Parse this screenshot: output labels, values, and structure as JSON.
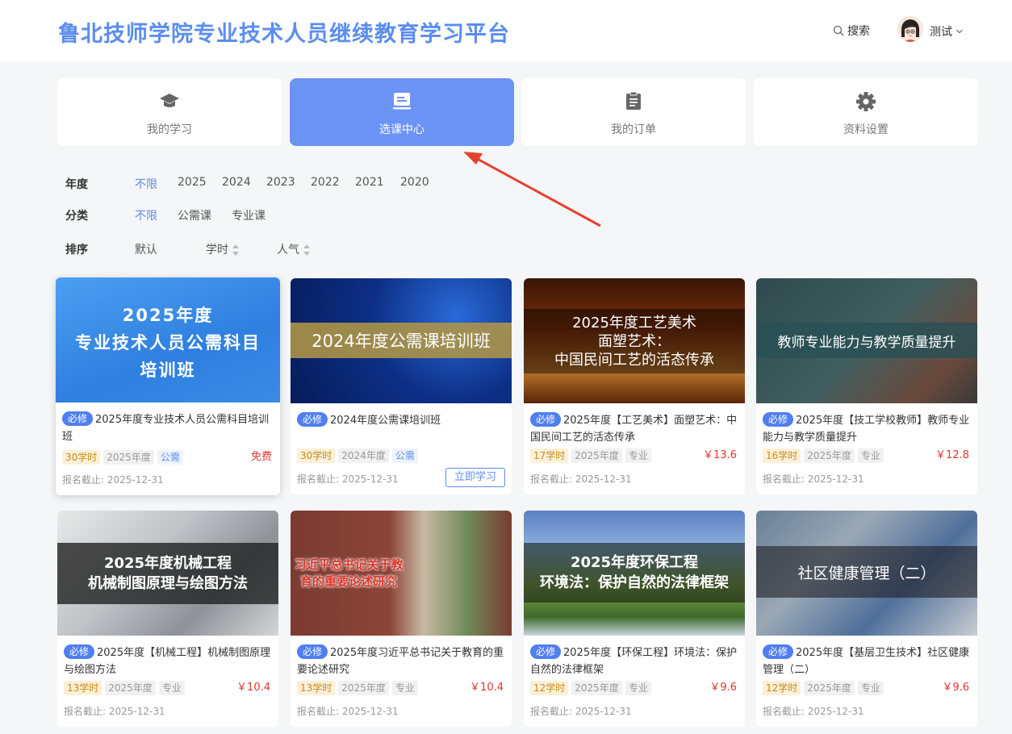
{
  "header": {
    "title": "鲁北技师学院专业技术人员继续教育学习平台",
    "search_label": "搜索",
    "user_name": "测试"
  },
  "nav": [
    {
      "label": "我的学习",
      "icon": "graduation-cap-icon",
      "active": false
    },
    {
      "label": "选课中心",
      "icon": "course-board-icon",
      "active": true
    },
    {
      "label": "我的订单",
      "icon": "clipboard-icon",
      "active": false
    },
    {
      "label": "资料设置",
      "icon": "gear-icon",
      "active": false
    }
  ],
  "filters": {
    "year": {
      "label": "年度",
      "options": [
        "不限",
        "2025",
        "2024",
        "2023",
        "2022",
        "2021",
        "2020"
      ],
      "selected": "不限"
    },
    "category": {
      "label": "分类",
      "options": [
        "不限",
        "公需课",
        "专业课"
      ],
      "selected": "不限"
    },
    "sort": {
      "label": "排序",
      "options": [
        "默认",
        "学时",
        "人气"
      ]
    }
  },
  "courses": [
    {
      "cover_text": "2025年度\n专业技术人员公需科目\n培训班",
      "badge": "必修",
      "title": "2025年度专业技术人员公需科目培训班",
      "hours": "30学时",
      "year": "2025年度",
      "type": "公需",
      "price": "免费",
      "deadline": "报名截止: 2025-12-31"
    },
    {
      "cover_text": "2024年度公需课培训班",
      "badge": "必修",
      "title": "2024年度公需课培训班",
      "hours": "30学时",
      "year": "2024年度",
      "type": "公需",
      "price": "",
      "button": "立即学习",
      "deadline": "报名截止: 2025-12-31"
    },
    {
      "cover_text": "2025年度工艺美术\n面塑艺术：\n中国民间工艺的活态传承",
      "badge": "必修",
      "title": "2025年度【工艺美术】面塑艺术：中国民间工艺的活态传承",
      "hours": "17学时",
      "year": "2025年度",
      "type": "专业",
      "price": "￥13.6",
      "deadline": "报名截止: 2025-12-31"
    },
    {
      "cover_text": "教师专业能力与教学质量提升",
      "badge": "必修",
      "title": "2025年度【技工学校教师】教师专业能力与教学质量提升",
      "hours": "16学时",
      "year": "2025年度",
      "type": "专业",
      "price": "￥12.8",
      "deadline": "报名截止: 2025-12-31"
    },
    {
      "cover_text": "2025年度机械工程\n机械制图原理与绘图方法",
      "badge": "必修",
      "title": "2025年度【机械工程】机械制图原理与绘图方法",
      "hours": "13学时",
      "year": "2025年度",
      "type": "专业",
      "price": "￥10.4",
      "deadline": "报名截止: 2025-12-31"
    },
    {
      "cover_text": "习近平总书记关于教\n育的重要论述研究",
      "badge": "必修",
      "title": "2025年度习近平总书记关于教育的重要论述研究",
      "hours": "13学时",
      "year": "2025年度",
      "type": "专业",
      "price": "￥10.4",
      "deadline": "报名截止: 2025-12-31"
    },
    {
      "cover_text": "2025年度环保工程\n环境法：保护自然的法律框架",
      "badge": "必修",
      "title": "2025年度【环保工程】环境法：保护自然的法律框架",
      "hours": "12学时",
      "year": "2025年度",
      "type": "专业",
      "price": "￥9.6",
      "deadline": "报名截止: 2025-12-31"
    },
    {
      "cover_text": "社区健康管理（二）",
      "badge": "必修",
      "title": "2025年度【基层卫生技术】社区健康管理（二）",
      "hours": "12学时",
      "year": "2025年度",
      "type": "专业",
      "price": "￥9.6",
      "deadline": "报名截止: 2025-12-31"
    }
  ],
  "colors": {
    "accent": "#5b8def",
    "active_nav": "#6b93f6",
    "price": "#e2342d",
    "annotation_arrow": "#e2432f"
  }
}
